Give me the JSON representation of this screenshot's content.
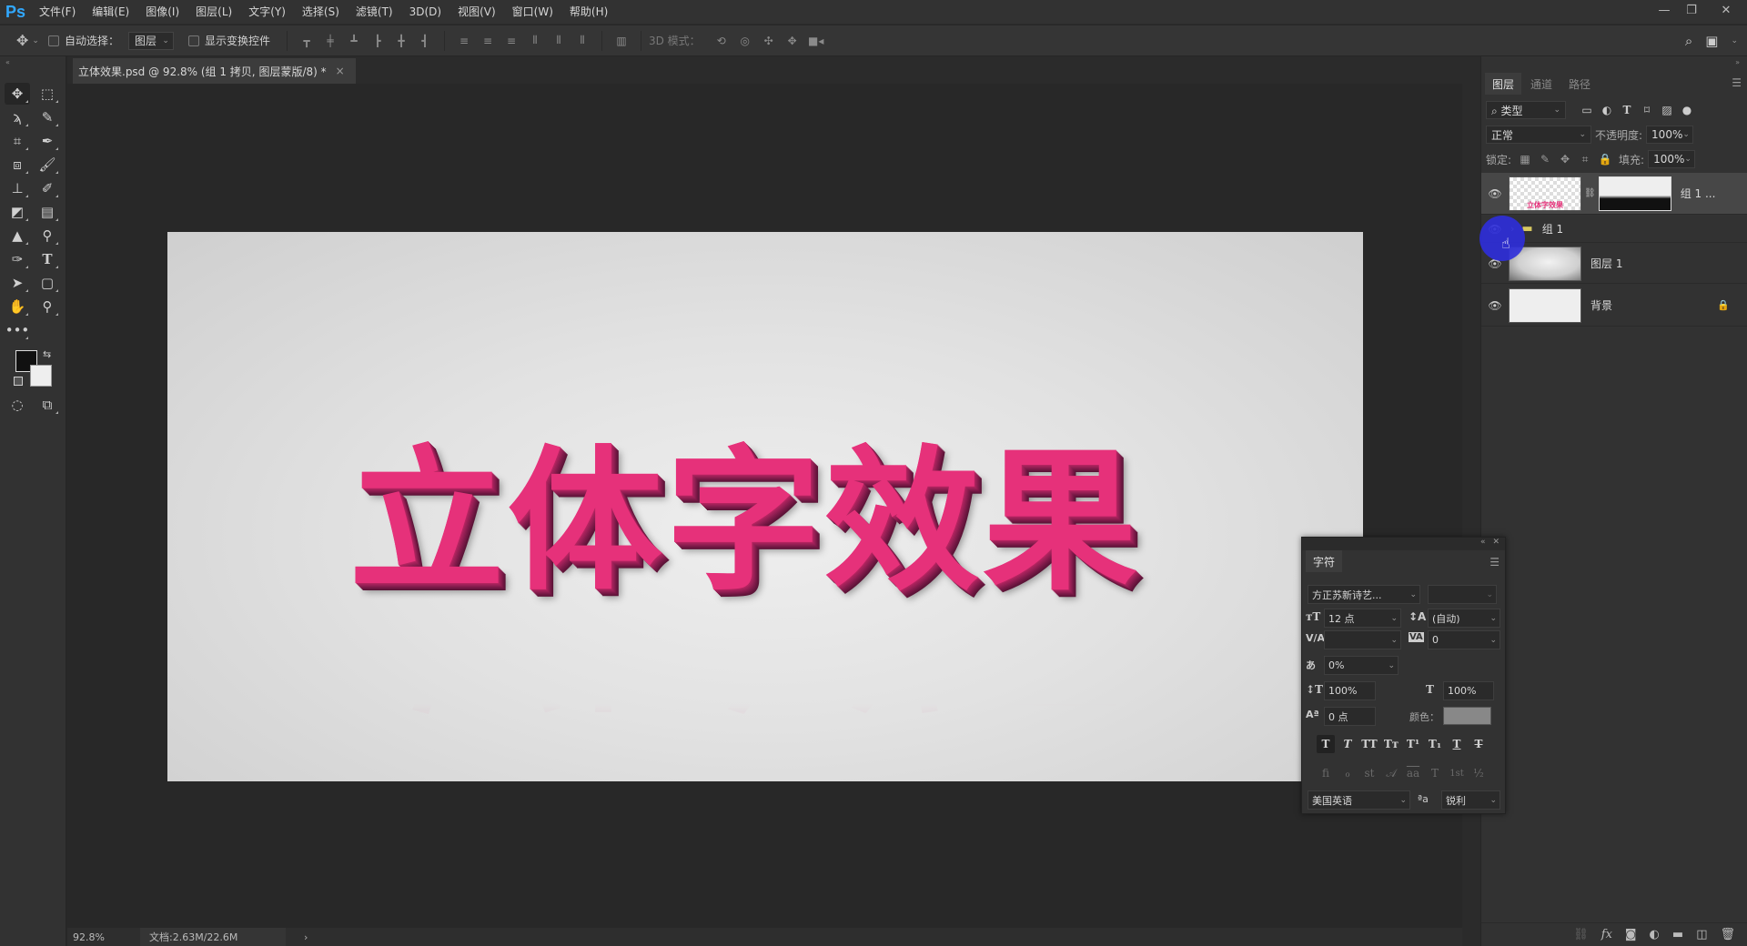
{
  "app": {
    "logo": "Ps"
  },
  "menu": [
    "文件(F)",
    "编辑(E)",
    "图像(I)",
    "图层(L)",
    "文字(Y)",
    "选择(S)",
    "滤镜(T)",
    "3D(D)",
    "视图(V)",
    "窗口(W)",
    "帮助(H)"
  ],
  "window_controls": {
    "minimize": "—",
    "restore": "❐",
    "close": "✕"
  },
  "options_bar": {
    "auto_select_label": "自动选择：",
    "auto_select_checked": false,
    "auto_select_target": "图层",
    "show_transform_label": "显示变换控件",
    "show_transform_checked": false,
    "mode_3d_label": "3D 模式："
  },
  "document": {
    "tab_title": "立体效果.psd @ 92.8% (组 1 拷贝, 图层蒙版/8) *",
    "close": "×",
    "canvas_text": "立体字效果"
  },
  "status": {
    "zoom": "92.8%",
    "doc_info": "文档:2.63M/22.6M",
    "arrow": "›"
  },
  "colors": {
    "foreground": "#111111",
    "background": "#eeeeee",
    "text_accent": "#e6317a",
    "cursor_highlight": "#2d2ddc"
  },
  "layers_panel": {
    "tabs": [
      "图层",
      "通道",
      "路径"
    ],
    "active_tab": 0,
    "filter_label": "类型",
    "blend_mode": "正常",
    "opacity_label": "不透明度:",
    "opacity": "100%",
    "lock_label": "锁定:",
    "fill_label": "填充:",
    "fill": "100%",
    "layers": [
      {
        "name": "组 1 ...",
        "visible": true,
        "selected": true,
        "type": "smart-object-with-mask"
      },
      {
        "name": "组 1",
        "visible": true,
        "selected": false,
        "type": "group"
      },
      {
        "name": "图层 1",
        "visible": true,
        "selected": false,
        "type": "pixel"
      },
      {
        "name": "背景",
        "visible": true,
        "selected": false,
        "type": "background",
        "locked": true
      }
    ]
  },
  "character_panel": {
    "tab": "字符",
    "font_family": "方正苏新诗艺...",
    "font_style": "",
    "font_size": "12 点",
    "leading": "(自动)",
    "kerning": "",
    "tracking": "0",
    "tsume": "0%",
    "vertical_scale": "100%",
    "horizontal_scale": "100%",
    "baseline_shift": "0 点",
    "color_label": "颜色：",
    "color": "#888888",
    "style_buttons": [
      "T",
      "T",
      "TT",
      "Tт",
      "T¹",
      "T₁",
      "T",
      "T"
    ],
    "opentype_buttons": [
      "ﬁ",
      "ℴ",
      "st",
      "𝒜",
      "aa",
      "T",
      "1st",
      "½"
    ],
    "language": "美国英语",
    "aa_label": "ªa",
    "antialias": "锐利"
  }
}
